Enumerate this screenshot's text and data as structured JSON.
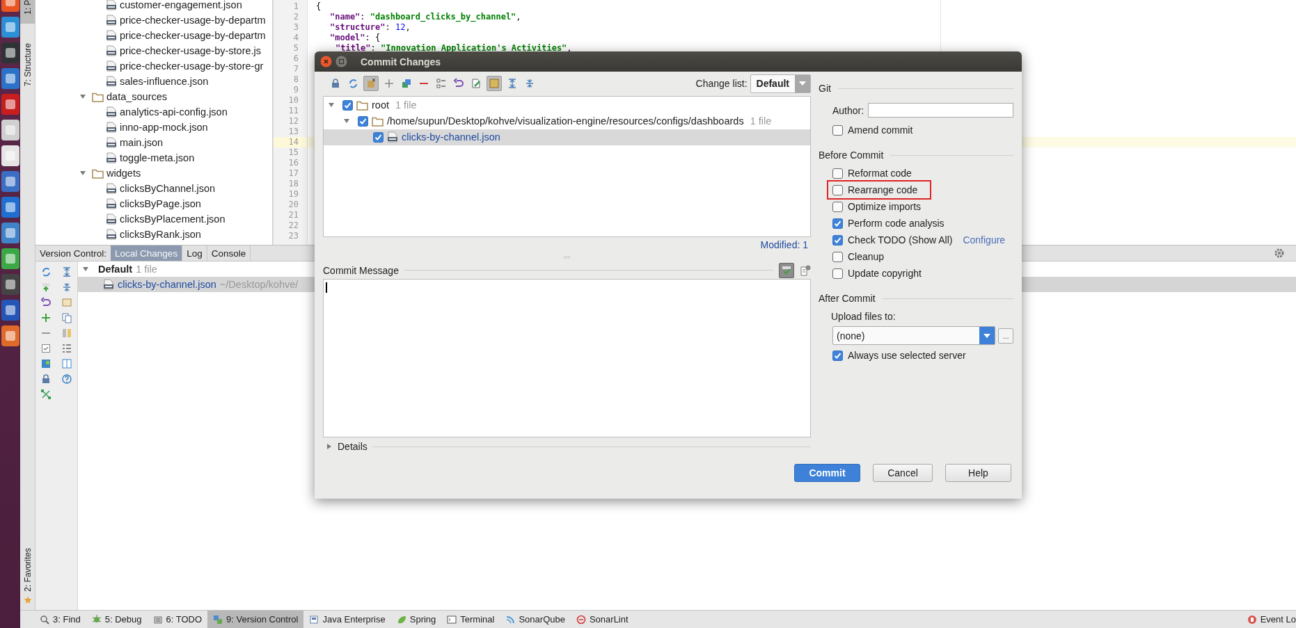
{
  "tool_strip": {
    "top_tabs": [
      {
        "label": "1: P",
        "selected": true
      },
      {
        "label": "7: Structure",
        "selected": false
      }
    ],
    "bottom_tabs": [
      {
        "label": "2: Favorites",
        "selected": false
      }
    ]
  },
  "project_tree": {
    "items": [
      {
        "kind": "continued",
        "children": [
          {
            "kind": "file",
            "label": "customer-engagement.json"
          },
          {
            "kind": "file",
            "label": "price-checker-usage-by-departm"
          },
          {
            "kind": "file",
            "label": "price-checker-usage-by-departm"
          },
          {
            "kind": "file",
            "label": "price-checker-usage-by-store.js"
          },
          {
            "kind": "file",
            "label": "price-checker-usage-by-store-gr"
          },
          {
            "kind": "file",
            "label": "sales-influence.json"
          }
        ]
      },
      {
        "kind": "folder",
        "label": "data_sources",
        "expanded": true,
        "children": [
          {
            "kind": "file",
            "label": "analytics-api-config.json"
          },
          {
            "kind": "file",
            "label": "inno-app-mock.json"
          },
          {
            "kind": "file",
            "label": "main.json"
          },
          {
            "kind": "file",
            "label": "toggle-meta.json"
          }
        ]
      },
      {
        "kind": "folder",
        "label": "widgets",
        "expanded": true,
        "children": [
          {
            "kind": "file",
            "label": "clicksByChannel.json"
          },
          {
            "kind": "file",
            "label": "clicksByPage.json"
          },
          {
            "kind": "file",
            "label": "clicksByPlacement.json"
          },
          {
            "kind": "file",
            "label": "clicksByRank.json"
          }
        ]
      }
    ]
  },
  "editor": {
    "lines": [
      {
        "number": "1",
        "highlighted": false,
        "tokens": [
          {
            "kind": "punct",
            "text": "{"
          }
        ]
      },
      {
        "number": "2",
        "highlighted": false,
        "tokens": [
          {
            "kind": "key",
            "text": "\"name\""
          },
          {
            "kind": "punct",
            "text": ": "
          },
          {
            "kind": "string",
            "text": "\"dashboard_clicks_by_channel\""
          },
          {
            "kind": "punct",
            "text": ","
          }
        ]
      },
      {
        "number": "3",
        "highlighted": false,
        "tokens": [
          {
            "kind": "key",
            "text": "\"structure\""
          },
          {
            "kind": "punct",
            "text": ": "
          },
          {
            "kind": "number",
            "text": "12"
          },
          {
            "kind": "punct",
            "text": ","
          }
        ]
      },
      {
        "number": "4",
        "highlighted": false,
        "tokens": [
          {
            "kind": "key",
            "text": "\"model\""
          },
          {
            "kind": "punct",
            "text": ": {"
          }
        ]
      },
      {
        "number": "5",
        "highlighted": false,
        "indent": true,
        "tokens": [
          {
            "kind": "key",
            "text": "\"title\""
          },
          {
            "kind": "punct",
            "text": ": "
          },
          {
            "kind": "string",
            "text": "\"Innovation Application's Activities\""
          },
          {
            "kind": "punct",
            "text": ","
          }
        ]
      },
      {
        "number": "6",
        "highlighted": false
      },
      {
        "number": "7",
        "highlighted": false
      },
      {
        "number": "8",
        "highlighted": false
      },
      {
        "number": "9",
        "highlighted": false
      },
      {
        "number": "10",
        "highlighted": false
      },
      {
        "number": "11",
        "highlighted": false
      },
      {
        "number": "12",
        "highlighted": false
      },
      {
        "number": "13",
        "highlighted": false
      },
      {
        "number": "14",
        "highlighted": true
      },
      {
        "number": "15",
        "highlighted": false
      },
      {
        "number": "16",
        "highlighted": false
      },
      {
        "number": "17",
        "highlighted": false
      },
      {
        "number": "18",
        "highlighted": false
      },
      {
        "number": "19",
        "highlighted": false
      },
      {
        "number": "20",
        "highlighted": false
      },
      {
        "number": "21",
        "highlighted": false
      },
      {
        "number": "22",
        "highlighted": false
      },
      {
        "number": "23",
        "highlighted": false
      }
    ]
  },
  "version_control": {
    "title": "Version Control:",
    "tabs": [
      {
        "label": "Local Changes",
        "selected": true
      },
      {
        "label": "Log",
        "selected": false
      },
      {
        "label": "Console",
        "selected": false
      }
    ],
    "tree": {
      "label": "Default",
      "count": "1 file",
      "expanded": true,
      "children": [
        {
          "label": "clicks-by-channel.json",
          "path": "~/Desktop/kohve/",
          "selected": true
        }
      ]
    }
  },
  "dialog": {
    "title": "Commit Changes",
    "change_list": {
      "label": "Change list:",
      "value": "Default"
    },
    "changes_tree": [
      {
        "label": "root",
        "count": "1 file",
        "checked": true,
        "expanded": true,
        "children": [
          {
            "label": "/home/supun/Desktop/kohve/visualization-engine/resources/configs/dashboards",
            "count": "1 file",
            "checked": true,
            "expanded": true,
            "children": [
              {
                "label": "clicks-by-channel.json",
                "checked": true,
                "selected": true
              }
            ]
          }
        ]
      }
    ],
    "modified": "Modified: 1",
    "commit_message": {
      "label": "Commit Message"
    },
    "details": {
      "label": "Details",
      "expanded": false
    },
    "git": {
      "heading": "Git",
      "author": {
        "label": "Author:"
      },
      "amend": {
        "label": "Amend commit",
        "checked": false
      }
    },
    "before_commit": {
      "heading": "Before Commit",
      "options": [
        {
          "label": "Reformat code",
          "checked": false,
          "highlighted": false
        },
        {
          "label": "Rearrange code",
          "checked": false,
          "highlighted": true
        },
        {
          "label": "Optimize imports",
          "checked": false,
          "highlighted": false
        },
        {
          "label": "Perform code analysis",
          "checked": true,
          "highlighted": false
        },
        {
          "label": "Check TODO (Show All)",
          "checked": true,
          "highlighted": false,
          "link": "Configure"
        },
        {
          "label": "Cleanup",
          "checked": false,
          "highlighted": false
        },
        {
          "label": "Update copyright",
          "checked": false,
          "highlighted": false
        }
      ]
    },
    "after_commit": {
      "heading": "After Commit",
      "upload": {
        "label": "Upload files to:",
        "value": "(none)",
        "button": "..."
      },
      "always": {
        "label": "Always use selected server",
        "checked": true
      }
    },
    "buttons": [
      {
        "label": "Commit",
        "default": true
      },
      {
        "label": "Cancel",
        "default": false
      },
      {
        "label": "Help",
        "default": false
      }
    ]
  },
  "bottom_bar": {
    "tools": [
      {
        "label": "3: Find",
        "selected": false
      },
      {
        "label": "5: Debug",
        "selected": false
      },
      {
        "label": "6: TODO",
        "selected": false
      },
      {
        "label": "9: Version Control",
        "selected": true
      },
      {
        "label": "Java Enterprise",
        "selected": false
      },
      {
        "label": "Spring",
        "selected": false
      },
      {
        "label": "Terminal",
        "selected": false
      },
      {
        "label": "SonarQube",
        "selected": false
      },
      {
        "label": "SonarLint",
        "selected": false
      }
    ],
    "right_tool": {
      "label": "Event Lo"
    }
  }
}
